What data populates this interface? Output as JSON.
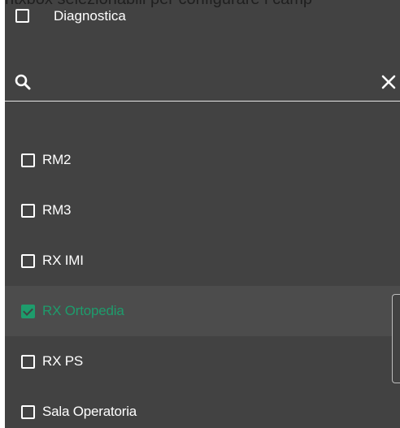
{
  "background_text": "ntxbox selezionabili per configurare i camp",
  "filter_header": {
    "label": "Diagnostica",
    "checked": false
  },
  "search": {
    "value": "",
    "placeholder": "",
    "search_icon": "search-icon",
    "clear_icon": "close-icon"
  },
  "options": [
    {
      "label": "RM2",
      "checked": false
    },
    {
      "label": "RM3",
      "checked": false
    },
    {
      "label": "RX IMI",
      "checked": false
    },
    {
      "label": "RX Ortopedia",
      "checked": true
    },
    {
      "label": "RX PS",
      "checked": false
    },
    {
      "label": "Sala Operatoria",
      "checked": false
    }
  ],
  "colors": {
    "panel_background": "#424242",
    "selected_row": "#4c4c4c",
    "accent": "#1e9c6c",
    "text": "#ffffff"
  }
}
